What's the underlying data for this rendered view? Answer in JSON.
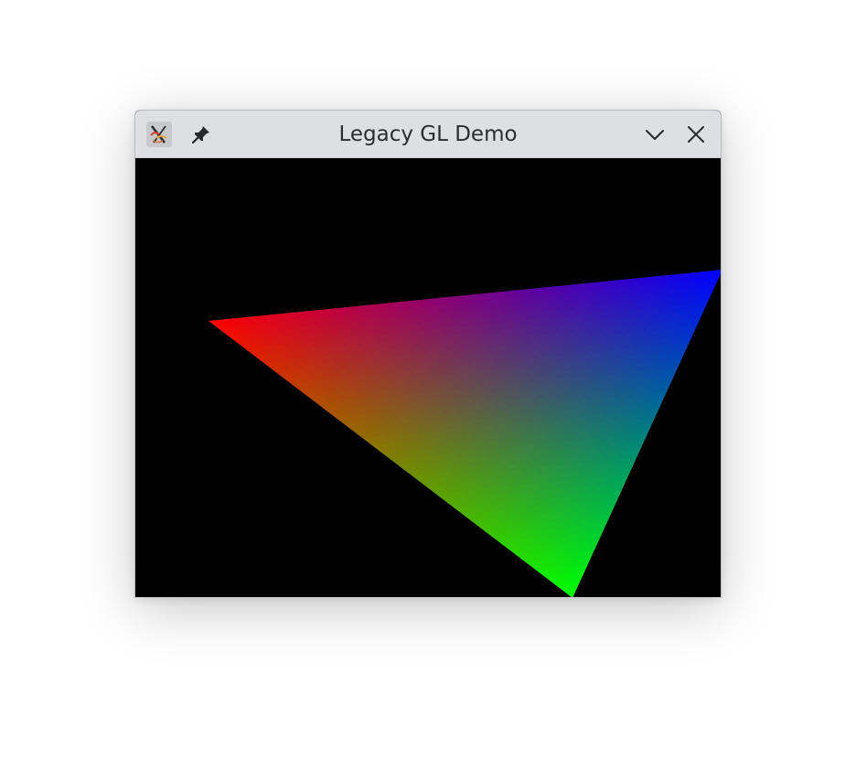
{
  "window": {
    "title": "Legacy GL Demo",
    "icons": {
      "app": "x-app-icon",
      "pin": "pin-icon",
      "minimize": "chevron-down-icon",
      "close": "close-icon"
    }
  },
  "scene": {
    "background": "#000000",
    "vertex_colors": [
      "#ff0000",
      "#00ff00",
      "#0000ff"
    ]
  }
}
